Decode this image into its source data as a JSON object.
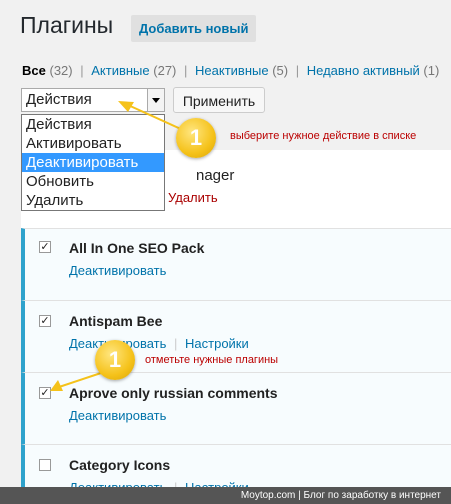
{
  "header": {
    "title": "Плагины",
    "add_new": "Добавить новый"
  },
  "filters": {
    "all": {
      "label": "Все",
      "count": "(32)"
    },
    "active": {
      "label": "Активные",
      "count": "(27)"
    },
    "inactive": {
      "label": "Неактивные",
      "count": "(5)"
    },
    "recent": {
      "label": "Недавно активный",
      "count": "(1)"
    }
  },
  "bulk": {
    "selected": "Действия",
    "apply": "Применить",
    "options": [
      "Действия",
      "Активировать",
      "Деактивировать",
      "Обновить",
      "Удалить"
    ],
    "highlighted_index": 2
  },
  "hidden_row": {
    "name_fragment": "nager",
    "action_fragment": "Удалить"
  },
  "plugins": [
    {
      "name": "All In One SEO Pack",
      "checked": true,
      "actions": [
        "Деактивировать"
      ]
    },
    {
      "name": "Antispam Bee",
      "checked": true,
      "actions": [
        "Деактивировать",
        "Настройки"
      ]
    },
    {
      "name": "Aprove only russian comments",
      "checked": true,
      "actions": [
        "Деактивировать"
      ]
    },
    {
      "name": "Category Icons",
      "checked": false,
      "actions": [
        "Деактивировать",
        "Настройки"
      ]
    }
  ],
  "annotations": {
    "badge_label": "1",
    "note_top": "выберите нужное действие в списке",
    "note_bottom": "отметьте нужные плагины"
  },
  "footer": "Moytop.com | Блог по заработку в интернет",
  "colors": {
    "accent": "#0073aa",
    "active_border": "#2ea2cc",
    "highlight": "#3399ff",
    "annotation": "#f5c21a"
  }
}
